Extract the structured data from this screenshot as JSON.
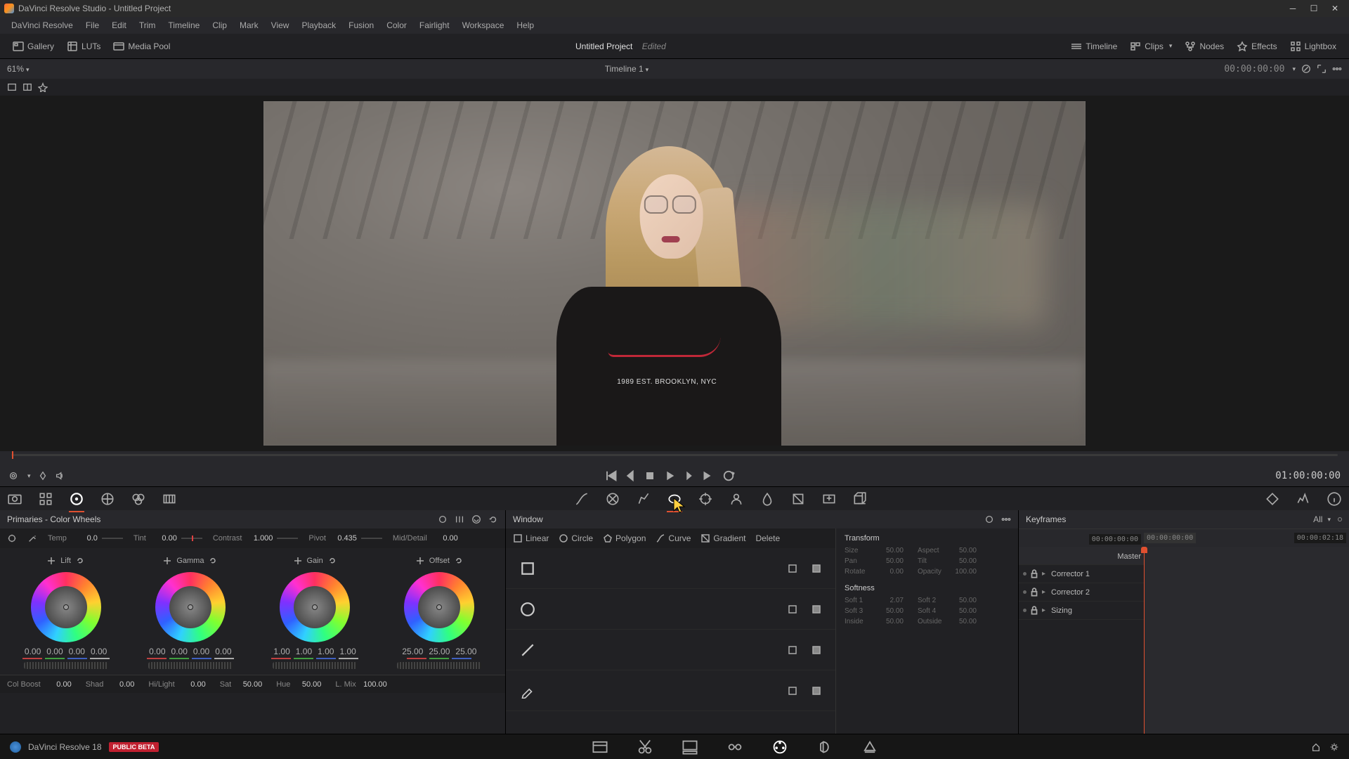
{
  "titlebar": {
    "title": "DaVinci Resolve Studio - Untitled Project"
  },
  "menu": [
    "DaVinci Resolve",
    "File",
    "Edit",
    "Trim",
    "Timeline",
    "Clip",
    "Mark",
    "View",
    "Playback",
    "Fusion",
    "Color",
    "Fairlight",
    "Workspace",
    "Help"
  ],
  "toolbar": {
    "left": [
      {
        "label": "Gallery"
      },
      {
        "label": "LUTs"
      },
      {
        "label": "Media Pool"
      }
    ],
    "project": "Untitled Project",
    "edited": "Edited",
    "right": [
      {
        "label": "Timeline"
      },
      {
        "label": "Clips"
      },
      {
        "label": "Nodes"
      },
      {
        "label": "Effects"
      },
      {
        "label": "Lightbox"
      }
    ]
  },
  "zoom": {
    "value": "61%",
    "timeline_name": "Timeline 1",
    "timecode": "00:00:00:00"
  },
  "viewer": {
    "logo_text": "1989 EST. BROOKLYN, NYC"
  },
  "transport": {
    "timecode": "01:00:00:00"
  },
  "primaries": {
    "title": "Primaries - Color Wheels",
    "params": {
      "temp": {
        "label": "Temp",
        "value": "0.0"
      },
      "tint": {
        "label": "Tint",
        "value": "0.00"
      },
      "contrast": {
        "label": "Contrast",
        "value": "1.000"
      },
      "pivot": {
        "label": "Pivot",
        "value": "0.435"
      },
      "middetail": {
        "label": "Mid/Detail",
        "value": "0.00"
      }
    },
    "wheels": [
      {
        "name": "Lift",
        "values": [
          "0.00",
          "0.00",
          "0.00",
          "0.00"
        ]
      },
      {
        "name": "Gamma",
        "values": [
          "0.00",
          "0.00",
          "0.00",
          "0.00"
        ]
      },
      {
        "name": "Gain",
        "values": [
          "1.00",
          "1.00",
          "1.00",
          "1.00"
        ]
      },
      {
        "name": "Offset",
        "values": [
          "25.00",
          "25.00",
          "25.00"
        ]
      }
    ],
    "bottom": {
      "colboost": {
        "label": "Col Boost",
        "value": "0.00"
      },
      "shad": {
        "label": "Shad",
        "value": "0.00"
      },
      "hilight": {
        "label": "Hi/Light",
        "value": "0.00"
      },
      "sat": {
        "label": "Sat",
        "value": "50.00"
      },
      "hue": {
        "label": "Hue",
        "value": "50.00"
      },
      "lmix": {
        "label": "L. Mix",
        "value": "100.00"
      }
    }
  },
  "window": {
    "title": "Window",
    "tabs": [
      "Linear",
      "Circle",
      "Polygon",
      "Curve",
      "Gradient",
      "Delete"
    ],
    "transform": {
      "title": "Transform",
      "fields": [
        {
          "label": "Size",
          "value": "50.00"
        },
        {
          "label": "Aspect",
          "value": "50.00"
        },
        {
          "label": "Pan",
          "value": "50.00"
        },
        {
          "label": "Tilt",
          "value": "50.00"
        },
        {
          "label": "Rotate",
          "value": "0.00"
        },
        {
          "label": "Opacity",
          "value": "100.00"
        }
      ]
    },
    "softness": {
      "title": "Softness",
      "fields": [
        {
          "label": "Soft 1",
          "value": "2.07"
        },
        {
          "label": "Soft 2",
          "value": "50.00"
        },
        {
          "label": "Soft 3",
          "value": "50.00"
        },
        {
          "label": "Soft 4",
          "value": "50.00"
        },
        {
          "label": "Inside",
          "value": "50.00"
        },
        {
          "label": "Outside",
          "value": "50.00"
        }
      ]
    }
  },
  "keyframes": {
    "title": "Keyframes",
    "filter": "All",
    "tc_start": "00:00:00:00",
    "tc_mid": "00:00:00:00",
    "tc_end": "00:00:02:18",
    "master": "Master",
    "tracks": [
      "Corrector 1",
      "Corrector 2",
      "Sizing"
    ]
  },
  "footer": {
    "app": "DaVinci Resolve 18",
    "beta": "PUBLIC BETA"
  }
}
